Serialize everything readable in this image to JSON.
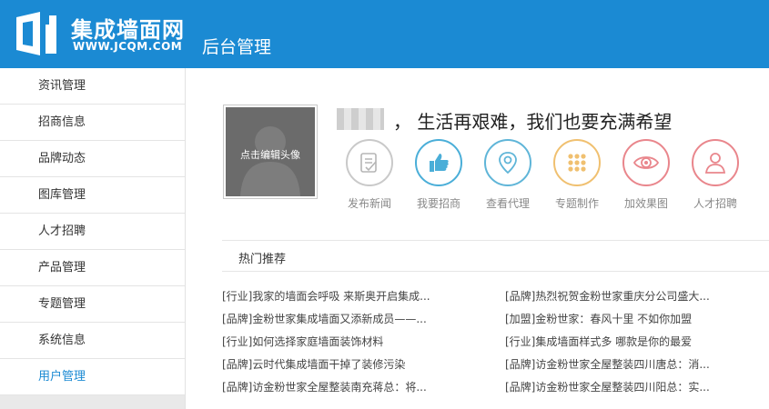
{
  "header": {
    "logo_text": "集成墙面网",
    "logo_url": "WWW.JCQM.COM",
    "title": "后台管理",
    "bg_color": "#1b8ad3"
  },
  "sidebar": {
    "items": [
      {
        "label": "资讯管理"
      },
      {
        "label": "招商信息"
      },
      {
        "label": "品牌动态"
      },
      {
        "label": "图库管理"
      },
      {
        "label": "人才招聘"
      },
      {
        "label": "产品管理"
      },
      {
        "label": "专题管理"
      },
      {
        "label": "系统信息"
      },
      {
        "label": "用户管理",
        "active": true
      }
    ]
  },
  "profile": {
    "avatar_label": "点击编辑头像",
    "slogan": "， 生活再艰难，我们也要充满希望"
  },
  "actions": [
    {
      "label": "发布新闻",
      "icon": "document-edit-icon",
      "color": "#c9c9c9"
    },
    {
      "label": "我要招商",
      "icon": "thumbs-up-icon",
      "color": "#4aaed8"
    },
    {
      "label": "查看代理",
      "icon": "location-pin-icon",
      "color": "#5fb5d8"
    },
    {
      "label": "专题制作",
      "icon": "grid-dots-icon",
      "color": "#f0c070"
    },
    {
      "label": "加效果图",
      "icon": "eye-icon",
      "color": "#e9868c"
    },
    {
      "label": "人才招聘",
      "icon": "person-icon",
      "color": "#e9868c"
    }
  ],
  "hot": {
    "title": "热门推荐",
    "left": [
      "[行业]我家的墙面会呼吸 来斯奥开启集成...",
      "[品牌]金粉世家集成墙面又添新成员——...",
      "[行业]如何选择家庭墙面装饰材料",
      "[品牌]云时代集成墙面干掉了装修污染",
      "[品牌]访金粉世家全屋整装南充蒋总：将..."
    ],
    "right": [
      "[品牌]热烈祝贺金粉世家重庆分公司盛大...",
      "[加盟]金粉世家：春风十里 不如你加盟",
      "[行业]集成墙面样式多 哪款是你的最爱",
      "[品牌]访金粉世家全屋整装四川唐总：消...",
      "[品牌]访金粉世家全屋整装四川阳总：实..."
    ]
  }
}
